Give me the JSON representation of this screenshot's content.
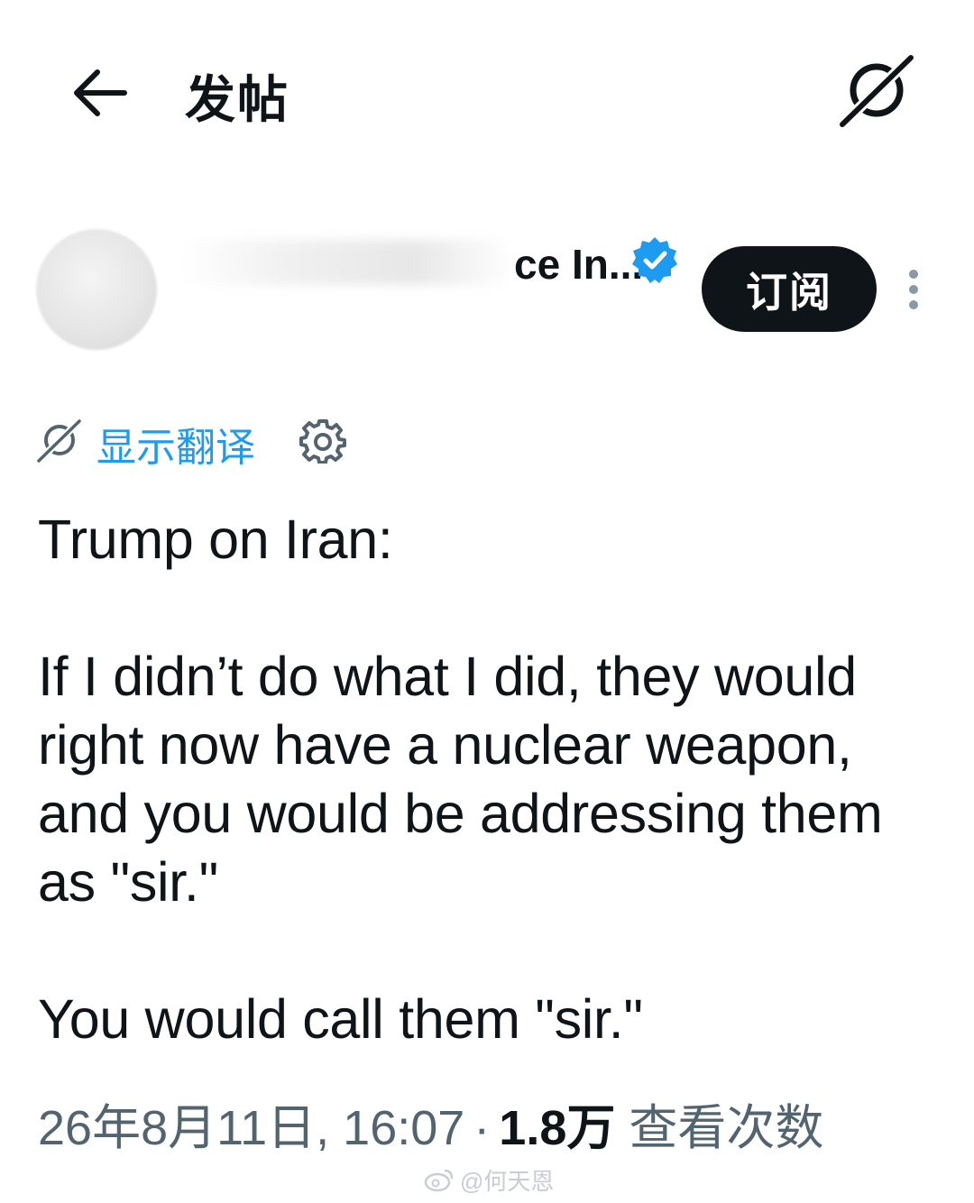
{
  "header": {
    "title": "发帖",
    "back_icon": "arrow-left-icon",
    "grok_icon": "grok-icon"
  },
  "author": {
    "display_name": "ce In...",
    "verified_icon": "verified-badge-icon",
    "verified_color": "#1d9bf0",
    "subscribe_label": "订阅",
    "more_icon": "more-vertical-icon"
  },
  "translate": {
    "label": "显示翻译",
    "icon": "grok-icon",
    "settings_icon": "gear-icon",
    "link_color": "#1d9bf0"
  },
  "tweet": {
    "paragraphs": [
      "Trump on Iran:",
      "If I didn’t do what I did, they would right now have a nuclear weapon, and you would be addressing them as \"sir.\"",
      "You would call them \"sir.\""
    ]
  },
  "meta": {
    "timestamp": "26年8月11日, 16:07",
    "separator": "·",
    "views_count": "1.8万",
    "views_label": "查看次数"
  },
  "watermark": {
    "text": "@何天恩",
    "icon": "weibo-icon"
  }
}
